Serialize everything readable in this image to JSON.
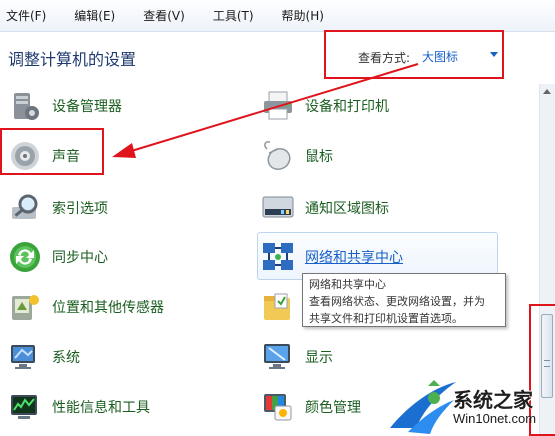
{
  "menu": [
    "文件(F)",
    "编辑(E)",
    "查看(V)",
    "工具(T)",
    "帮助(H)"
  ],
  "header": {
    "title": "调整计算机的设置",
    "view_label": "查看方式:",
    "view_value": "大图标"
  },
  "items": {
    "device_manager": "设备管理器",
    "devices_printers": "设备和打印机",
    "sound": "声音",
    "mouse": "鼠标",
    "indexing": "索引选项",
    "notification_icons": "通知区域图标",
    "sync_center": "同步中心",
    "network_center": "网络和共享中心",
    "location_sensors": "位置和其他传感器",
    "system": "系统",
    "display": "显示",
    "performance": "性能信息和工具",
    "color_management": "颜色管理"
  },
  "tooltip": {
    "title": "网络和共享中心",
    "line1": "查看网络状态、更改网络设置，并为",
    "line2": "共享文件和打印机设置首选项。"
  },
  "watermark": {
    "name": "系统之家",
    "url": "Win10net.com"
  },
  "colors": {
    "annotation_red": "#e0141c",
    "link_blue": "#1660c7",
    "item_green": "#1b5e20"
  }
}
